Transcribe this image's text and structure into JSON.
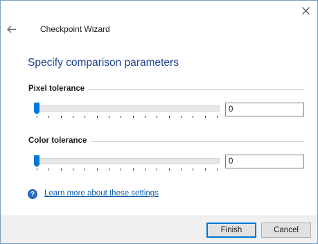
{
  "window": {
    "title": "Checkpoint Wizard",
    "close_icon": "close-icon",
    "back_icon": "arrow-left-icon"
  },
  "page": {
    "heading": "Specify comparison parameters"
  },
  "pixel_tolerance": {
    "label": "Pixel tolerance",
    "value": "0",
    "slider_fraction": 0,
    "tick_count": 16
  },
  "color_tolerance": {
    "label": "Color tolerance",
    "value": "0",
    "slider_fraction": 0,
    "tick_count": 16
  },
  "help": {
    "icon": "question-circle-icon",
    "symbol": "?",
    "link_text": "Learn more about these settings"
  },
  "footer": {
    "finish_label": "Finish",
    "cancel_label": "Cancel"
  },
  "colors": {
    "heading": "#1f3f8f",
    "accent": "#0078d7",
    "link": "#0b5cad"
  }
}
